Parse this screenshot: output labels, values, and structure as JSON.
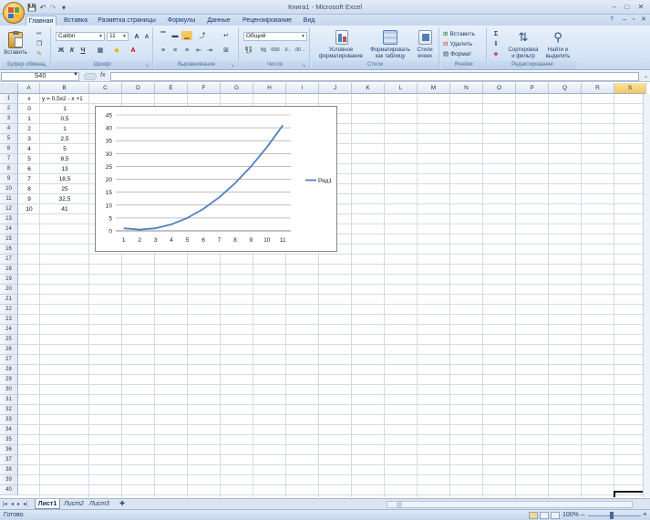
{
  "window": {
    "title": "Книга1 - Microsoft Excel",
    "controls": {
      "minimize": "–",
      "maximize": "□",
      "close": "✕"
    }
  },
  "quick_access": {
    "save": "💾",
    "undo": "↶",
    "redo": "↷",
    "more": "▾"
  },
  "ribbon": {
    "tabs": [
      "Главная",
      "Вставка",
      "Разметка страницы",
      "Формулы",
      "Данные",
      "Рецензирование",
      "Вид"
    ],
    "active_tab": "Главная",
    "clipboard": {
      "paste": "Вставить",
      "label": "Буфер обмена"
    },
    "font": {
      "name": "Calibri",
      "size": "11",
      "bold": "Ж",
      "italic": "К",
      "underline": "Ч",
      "grow": "A",
      "shrink": "A",
      "label": "Шрифт"
    },
    "alignment": {
      "label": "Выравнивание"
    },
    "number": {
      "format": "Общий",
      "percent": "%",
      "thousands": "000",
      "label": "Число"
    },
    "styles": {
      "conditional": "Условное",
      "conditional2": "форматирование",
      "table": "Форматировать",
      "table2": "как таблицу",
      "cell": "Стили",
      "cell2": "ячеек",
      "label": "Стили"
    },
    "cells": {
      "insert": "Вставить",
      "delete": "Удалить",
      "format": "Формат",
      "label": "Ячейки"
    },
    "editing": {
      "sum": "Σ",
      "sort": "Сортировка",
      "sort2": "и фильтр",
      "find": "Найти и",
      "find2": "выделить",
      "label": "Редактирование"
    }
  },
  "formula_bar": {
    "name_box": "S40",
    "fx": "fx",
    "value": ""
  },
  "columns": [
    "A",
    "B",
    "C",
    "D",
    "E",
    "F",
    "G",
    "H",
    "I",
    "J",
    "K",
    "L",
    "M",
    "N",
    "O",
    "P",
    "Q",
    "R",
    "S"
  ],
  "selected_column": "S",
  "rows": [
    "1",
    "2",
    "3",
    "4",
    "5",
    "6",
    "7",
    "8",
    "9",
    "10",
    "11",
    "12",
    "13",
    "14",
    "15",
    "16",
    "17",
    "18",
    "19",
    "20",
    "21",
    "22",
    "23",
    "24",
    "25",
    "26",
    "27",
    "28",
    "29",
    "30",
    "31",
    "32",
    "33",
    "34",
    "35",
    "36",
    "37",
    "38",
    "39",
    "40"
  ],
  "table": {
    "header": {
      "x": "x",
      "y": "y = 0,5x2 - x +1"
    },
    "x_values": [
      "0",
      "1",
      "2",
      "3",
      "4",
      "5",
      "6",
      "7",
      "8",
      "9",
      "10"
    ],
    "y_values": [
      "1",
      "0,5",
      "1",
      "2,5",
      "5",
      "8,5",
      "13",
      "18,5",
      "25",
      "32,5",
      "41"
    ]
  },
  "chart_data": {
    "type": "line",
    "categories": [
      "1",
      "2",
      "3",
      "4",
      "5",
      "6",
      "7",
      "8",
      "9",
      "10",
      "11"
    ],
    "series": [
      {
        "name": "Ряд1",
        "values": [
          1,
          0.5,
          1,
          2.5,
          5,
          8.5,
          13,
          18.5,
          25,
          32.5,
          41
        ],
        "color": "#4f81bd"
      }
    ],
    "ylim": [
      0,
      45
    ],
    "yticks": [
      "0",
      "5",
      "10",
      "15",
      "20",
      "25",
      "30",
      "35",
      "40",
      "45"
    ],
    "title": "",
    "xlabel": "",
    "ylabel": "",
    "grid": true,
    "legend": "right"
  },
  "sheets": {
    "tabs": [
      "Лист1",
      "Лист2",
      "Лист3"
    ],
    "active": "Лист1",
    "nav": [
      "|◂",
      "◂",
      "▸",
      "▸|"
    ]
  },
  "status": {
    "ready": "Готово",
    "zoom": "100%",
    "zoom_minus": "–",
    "zoom_plus": "+"
  }
}
